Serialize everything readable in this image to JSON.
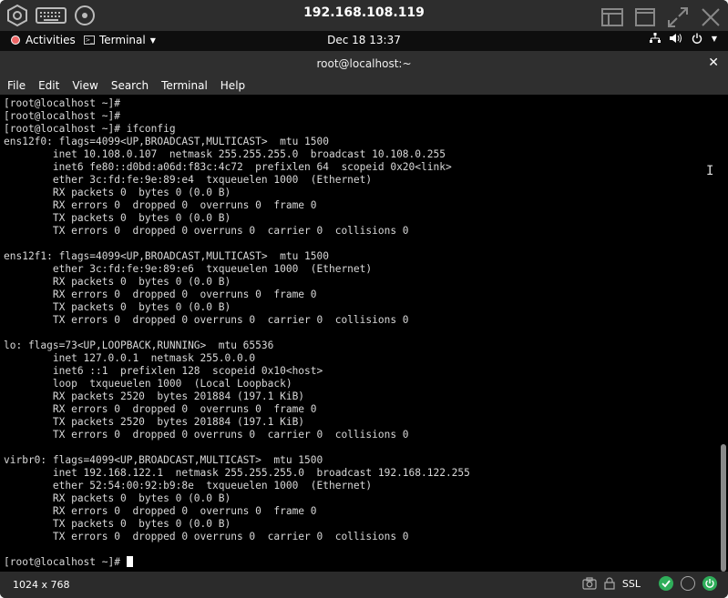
{
  "viewer": {
    "title": "192.168.108.119",
    "icons": [
      "settings-hex-icon",
      "keyboard-icon",
      "circle-icon",
      "window-icon",
      "maximize-icon",
      "fullscreen-icon",
      "close-icon"
    ]
  },
  "gnome": {
    "activities": "Activities",
    "app_menu": "Terminal",
    "clock": "Dec 18  13:37"
  },
  "terminal": {
    "title": "root@localhost:~",
    "menu": [
      "File",
      "Edit",
      "View",
      "Search",
      "Terminal",
      "Help"
    ],
    "lines": [
      "[root@localhost ~]#",
      "[root@localhost ~]#",
      "[root@localhost ~]# ifconfig",
      "ens12f0: flags=4099<UP,BROADCAST,MULTICAST>  mtu 1500",
      "        inet 10.108.0.107  netmask 255.255.255.0  broadcast 10.108.0.255",
      "        inet6 fe80::d0bd:a06d:f83c:4c72  prefixlen 64  scopeid 0x20<link>",
      "        ether 3c:fd:fe:9e:89:e4  txqueuelen 1000  (Ethernet)",
      "        RX packets 0  bytes 0 (0.0 B)",
      "        RX errors 0  dropped 0  overruns 0  frame 0",
      "        TX packets 0  bytes 0 (0.0 B)",
      "        TX errors 0  dropped 0 overruns 0  carrier 0  collisions 0",
      "",
      "ens12f1: flags=4099<UP,BROADCAST,MULTICAST>  mtu 1500",
      "        ether 3c:fd:fe:9e:89:e6  txqueuelen 1000  (Ethernet)",
      "        RX packets 0  bytes 0 (0.0 B)",
      "        RX errors 0  dropped 0  overruns 0  frame 0",
      "        TX packets 0  bytes 0 (0.0 B)",
      "        TX errors 0  dropped 0 overruns 0  carrier 0  collisions 0",
      "",
      "lo: flags=73<UP,LOOPBACK,RUNNING>  mtu 65536",
      "        inet 127.0.0.1  netmask 255.0.0.0",
      "        inet6 ::1  prefixlen 128  scopeid 0x10<host>",
      "        loop  txqueuelen 1000  (Local Loopback)",
      "        RX packets 2520  bytes 201884 (197.1 KiB)",
      "        RX errors 0  dropped 0  overruns 0  frame 0",
      "        TX packets 2520  bytes 201884 (197.1 KiB)",
      "        TX errors 0  dropped 0 overruns 0  carrier 0  collisions 0",
      "",
      "virbr0: flags=4099<UP,BROADCAST,MULTICAST>  mtu 1500",
      "        inet 192.168.122.1  netmask 255.255.255.0  broadcast 192.168.122.255",
      "        ether 52:54:00:92:b9:8e  txqueuelen 1000  (Ethernet)",
      "        RX packets 0  bytes 0 (0.0 B)",
      "        RX errors 0  dropped 0  overruns 0  frame 0",
      "        TX packets 0  bytes 0 (0.0 B)",
      "        TX errors 0  dropped 0 overruns 0  carrier 0  collisions 0",
      ""
    ],
    "prompt": "[root@localhost ~]# "
  },
  "status": {
    "resolution": "1024 x 768",
    "ssl": "SSL"
  },
  "colors": {
    "accent_green": "#2fae5a",
    "terminal_bg": "#000000"
  }
}
